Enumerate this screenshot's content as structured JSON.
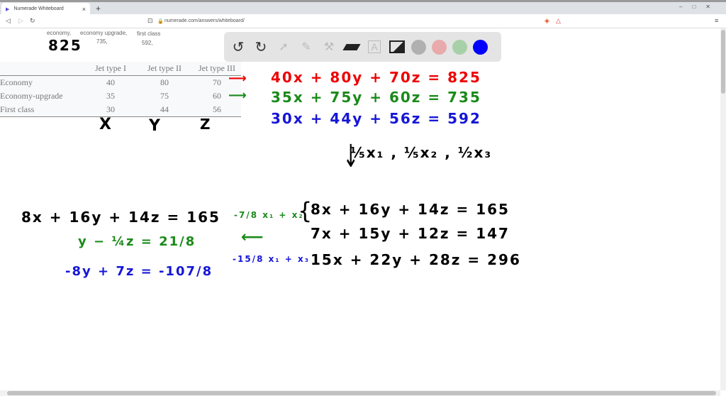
{
  "browser": {
    "tab_title": "Numerade Whiteboard",
    "url": "numerade.com/answers/whiteboard/"
  },
  "question": {
    "labels": [
      {
        "name": "economy,",
        "value": ""
      },
      {
        "name": "economy upgrade,",
        "value": "735,"
      },
      {
        "name": "first class",
        "value": "592,"
      }
    ]
  },
  "table": {
    "headers": [
      "",
      "Jet type I",
      "Jet type II",
      "Jet type III"
    ],
    "rows": [
      [
        "Economy",
        "40",
        "80",
        "70"
      ],
      [
        "Economy-upgrade",
        "35",
        "75",
        "60"
      ],
      [
        "First class",
        "30",
        "44",
        "56"
      ]
    ]
  },
  "toolbar": {
    "colors": [
      "#b0b0b0",
      "#e8aaaa",
      "#a8d0a8",
      "#0000ff"
    ]
  },
  "handwriting": {
    "n825": "825",
    "vars": [
      "X",
      "Y",
      "Z"
    ],
    "eq1": "40x + 80y + 70z = 825",
    "eq2": "35x + 75y + 60z = 735",
    "eq3": "30x + 44y + 56z = 592",
    "scale": "⅕x₁ , ⅕x₂ , ½x₃",
    "s1": "8x + 16y + 14z = 165",
    "s2": "7x + 15y + 12z = 147",
    "s3": "15x + 22y + 28z = 296",
    "op1": "-7/8 x₁ + x₂",
    "op2": "-15/8 x₁ + x₃",
    "l1": "8x + 16y + 14z = 165",
    "l2": "y − ¼z = 21/8",
    "l3": "-8y + 7z = -107/8"
  }
}
